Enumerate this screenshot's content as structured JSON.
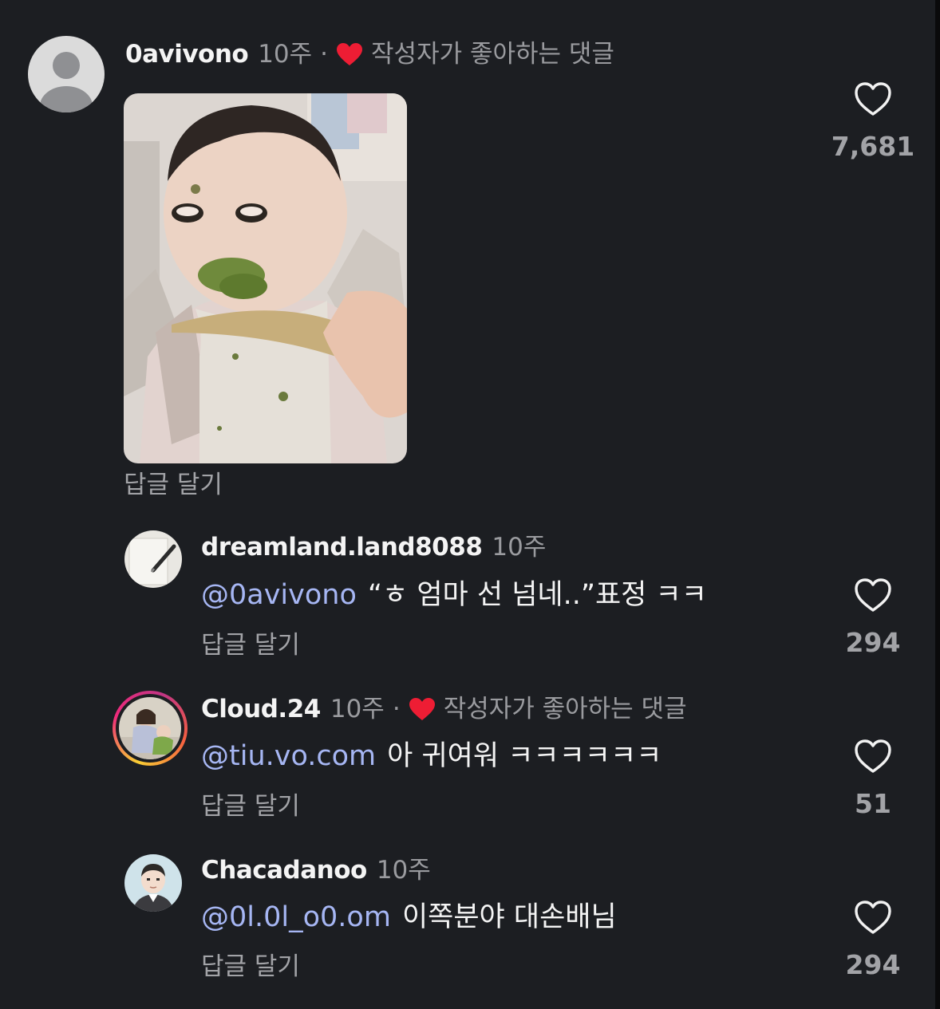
{
  "comments": [
    {
      "username": "0avivono",
      "time": "10주",
      "separator": "·",
      "liked_by_author": "작성자가 좋아하는 댓글",
      "reply_label": "답글 달기",
      "likes": "7,681"
    },
    {
      "username": "dreamland.land8088",
      "time": "10주",
      "mention": "@0avivono",
      "text": "“ㅎ 엄마 선 넘네..”표정 ㅋㅋ",
      "reply_label": "답글 달기",
      "likes": "294"
    },
    {
      "username": "Cloud.24",
      "time": "10주",
      "separator": "·",
      "liked_by_author": "작성자가 좋아하는 댓글",
      "mention": "@tiu.vo.com",
      "text": "아 귀여워 ㅋㅋㅋㅋㅋㅋ",
      "reply_label": "답글 달기",
      "likes": "51"
    },
    {
      "username": "Chacadanoo",
      "time": "10주",
      "mention": "@0l.0l_o0.om",
      "text": "이쪽분야 대손배님",
      "reply_label": "답글 달기",
      "likes": "294"
    }
  ],
  "colors": {
    "background": "#1c1e22",
    "mention": "#a6b6f3",
    "liked_heart": "#ee1d34",
    "secondary_text": "#9a9b9f"
  },
  "icons": {
    "like": "heart-outline-icon",
    "author_liked": "heart-filled-icon",
    "default_avatar": "person-silhouette-icon"
  }
}
